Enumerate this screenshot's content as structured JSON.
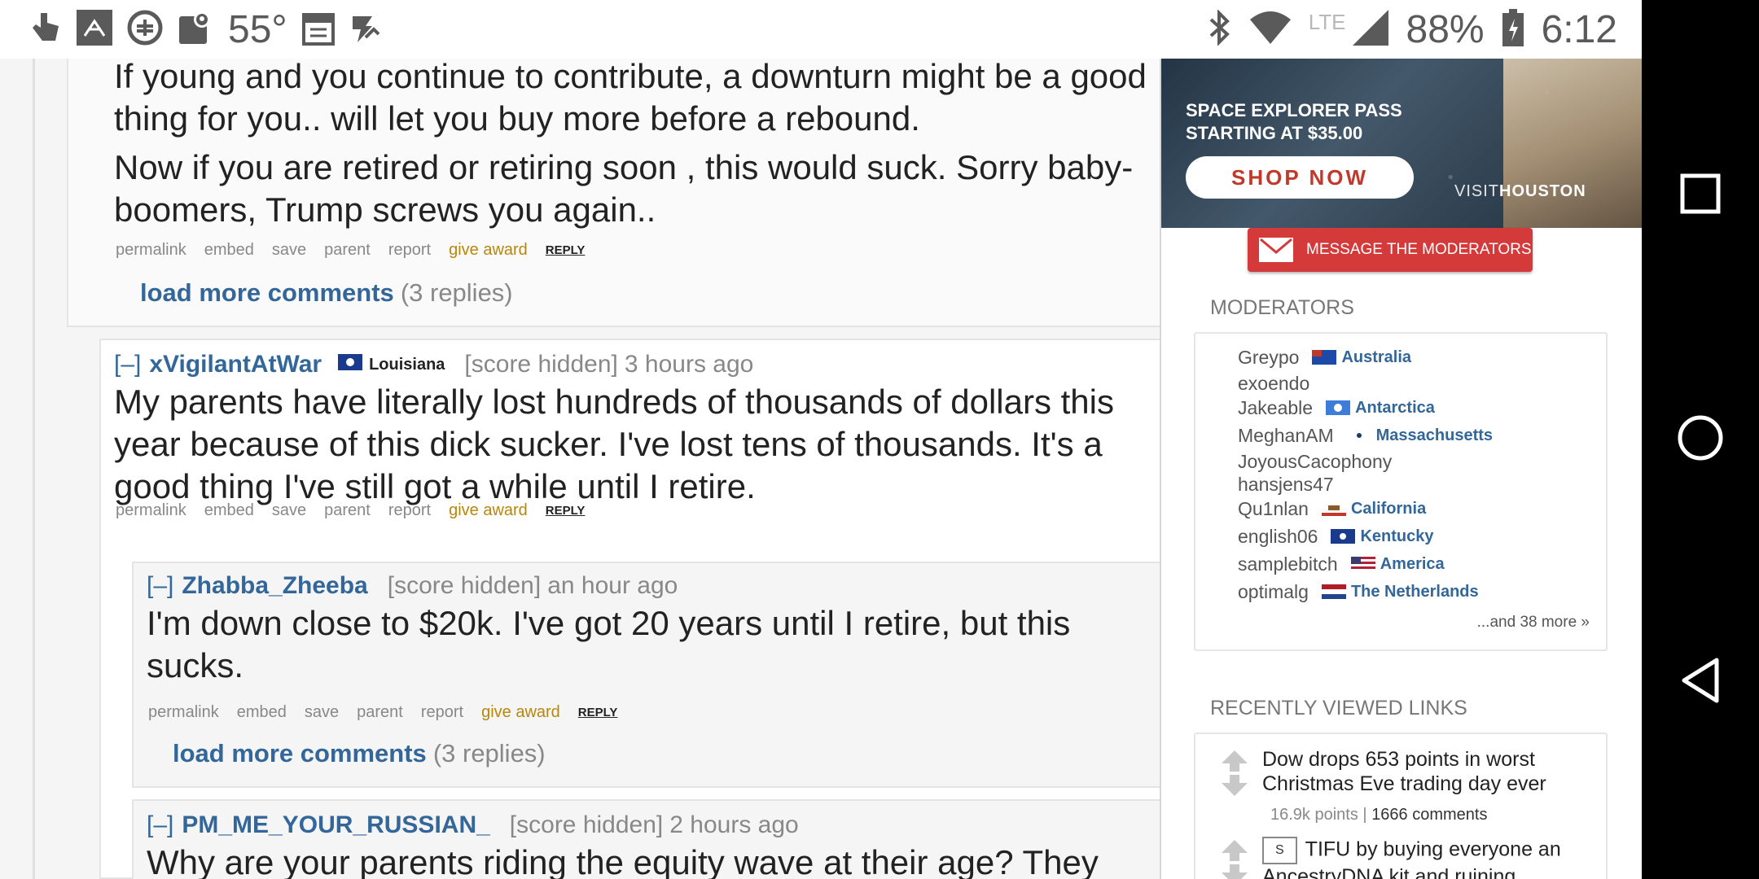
{
  "status_bar": {
    "temperature": "55°",
    "lte": "LTE",
    "battery": "88%",
    "clock": "6:12",
    "icons": [
      "touch-icon",
      "news-icon",
      "app-icon",
      "maps-icon",
      "calendar-icon",
      "check-icon",
      "bluetooth-icon",
      "wifi-icon",
      "signal-icon",
      "battery-icon"
    ]
  },
  "comments": [
    {
      "body": [
        "If young and you continue to contribute, a downturn might be a good thing for you.. will let you buy more before a rebound.",
        "Now if you are retired or retiring soon , this would suck. Sorry baby-boomers, Trump screws you again.."
      ],
      "actions": [
        "permalink",
        "embed",
        "save",
        "parent",
        "report",
        "give award",
        "REPLY"
      ],
      "load_more": {
        "label": "load more comments",
        "count": "(3 replies)"
      }
    },
    {
      "collapse": "[–]",
      "author": "xVigilantAtWar",
      "flair": "Louisiana",
      "score": "[score hidden]",
      "time": "3 hours ago",
      "body": "My parents have literally lost hundreds of thousands of dollars this year because of this dick sucker. I've lost tens of thousands. It's a good thing I've still got a while until I retire.",
      "actions": [
        "permalink",
        "embed",
        "save",
        "parent",
        "report",
        "give award",
        "REPLY"
      ]
    },
    {
      "collapse": "[–]",
      "author": "Zhabba_Zheeba",
      "score": "[score hidden]",
      "time": "an hour ago",
      "body": "I'm down close to $20k. I've got 20 years until I retire, but this sucks.",
      "actions": [
        "permalink",
        "embed",
        "save",
        "parent",
        "report",
        "give award",
        "REPLY"
      ],
      "load_more": {
        "label": "load more comments",
        "count": "(3 replies)"
      }
    },
    {
      "collapse": "[–]",
      "author": "PM_ME_YOUR_RUSSIAN_",
      "score": "[score hidden]",
      "time": "2 hours ago",
      "body": "Why are your parents riding the equity wave at their age? They"
    }
  ],
  "sidebar": {
    "ad": {
      "title": "SPACE EXPLORER PASS\nSTARTING AT $35.00",
      "button": "SHOP NOW",
      "brand_prefix": "VISIT",
      "brand": "HOUSTON"
    },
    "message_button": "MESSAGE THE MODERATORS",
    "moderators_heading": "MODERATORS",
    "moderators": [
      {
        "name": "Greypo",
        "flair": "Australia",
        "flag_color": "#1d4aa8"
      },
      {
        "name": "exoendo",
        "flair": "",
        "flag_color": ""
      },
      {
        "name": "Jakeable",
        "flair": "Antarctica",
        "flag_color": "#3b7dd8"
      },
      {
        "name": "MeghanAM",
        "flair": "Massachusetts",
        "flag_color": "#1a3a6e"
      },
      {
        "name": "JoyousCacophony",
        "flair": "",
        "flag_color": ""
      },
      {
        "name": "hansjens47",
        "flair": "",
        "flag_color": ""
      },
      {
        "name": "Qu1nlan",
        "flair": "California",
        "flag_color": "#c0392b"
      },
      {
        "name": "english06",
        "flair": "Kentucky",
        "flag_color": "#1a3a8e"
      },
      {
        "name": "samplebitch",
        "flair": "America",
        "flag_color": "#b22234"
      },
      {
        "name": "optimalg",
        "flair": "The Netherlands",
        "flag_color": "#21468b"
      }
    ],
    "more_link": "...and 38 more »",
    "recent_heading": "RECENTLY VIEWED LINKS",
    "recent_links": [
      {
        "title": "Dow drops 653 points in worst Christmas Eve trading day ever",
        "points": "16.9k points",
        "sep": "|",
        "comments": "1666 comments"
      },
      {
        "stamp": "S",
        "title": "TIFU by buying everyone an AncestryDNA kit and ruining"
      }
    ]
  }
}
